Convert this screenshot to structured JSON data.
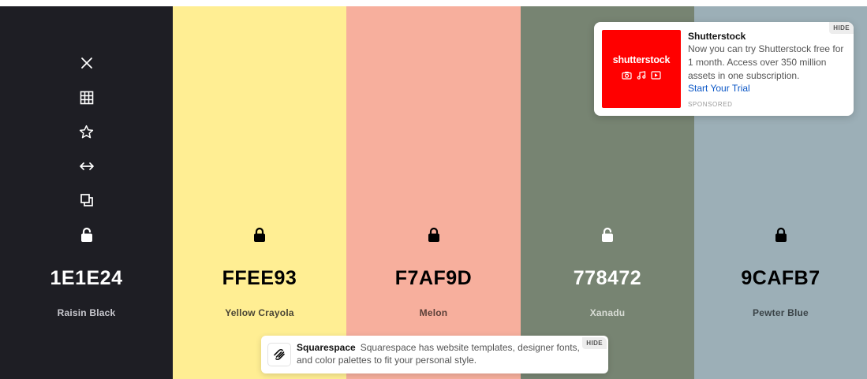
{
  "tools": [
    {
      "name": "close-icon"
    },
    {
      "name": "grid-icon"
    },
    {
      "name": "star-icon"
    },
    {
      "name": "arrows-horizontal-icon"
    },
    {
      "name": "copy-icon"
    }
  ],
  "colors": [
    {
      "hex": "1E1E24",
      "name": "Raisin Black",
      "bg": "#1E1E24",
      "fg": "#ffffff",
      "sub": "#c9c9cf",
      "locked": false
    },
    {
      "hex": "FFEE93",
      "name": "Yellow Crayola",
      "bg": "#FFEE93",
      "fg": "#000000",
      "sub": "#4a4535",
      "locked": true
    },
    {
      "hex": "F7AF9D",
      "name": "Melon",
      "bg": "#F7AF9D",
      "fg": "#000000",
      "sub": "#5a3f38",
      "locked": true
    },
    {
      "hex": "778472",
      "name": "Xanadu",
      "bg": "#778472",
      "fg": "#ffffff",
      "sub": "#d9ddd6",
      "locked": false
    },
    {
      "hex": "9CAFB7",
      "name": "Pewter Blue",
      "bg": "#9CAFB7",
      "fg": "#000000",
      "sub": "#3a4347",
      "locked": true
    }
  ],
  "ad_top": {
    "wordmark": "shutterstock",
    "title": "Shutterstock",
    "description": "Now you can try Shutterstock free for 1 month. Access over 350 million assets in one subscription.",
    "cta": "Start Your Trial",
    "sponsored": "SPONSORED",
    "hide": "HIDE",
    "brand_color": "#ff0000"
  },
  "ad_bottom": {
    "title": "Squarespace",
    "description": "Squarespace has website templates, designer fonts, and color palettes to fit your personal style.",
    "hide": "HIDE"
  }
}
